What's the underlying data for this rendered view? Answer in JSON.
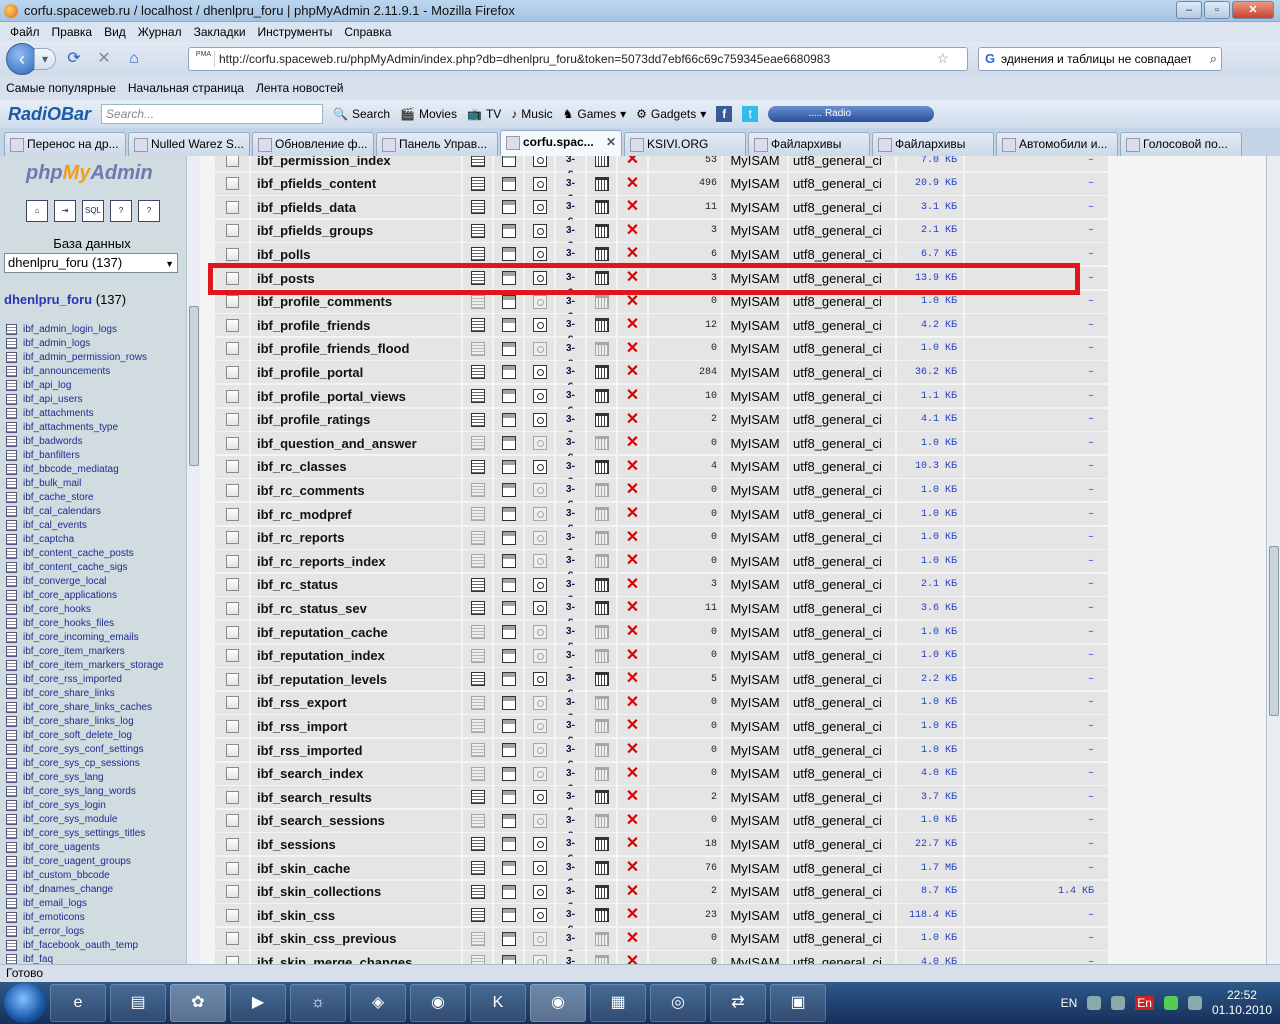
{
  "window": {
    "title": "corfu.spaceweb.ru / localhost / dhenlpru_foru | phpMyAdmin 2.11.9.1 - Mozilla Firefox"
  },
  "menu": [
    "Файл",
    "Правка",
    "Вид",
    "Журнал",
    "Закладки",
    "Инструменты",
    "Справка"
  ],
  "nav": {
    "url": "http://corfu.spaceweb.ru/phpMyAdmin/index.php?db=dhenlpru_foru&token=5073dd7ebf66c69c759345eae6680983",
    "search_value": "эдинения и таблицы не совпадает:"
  },
  "bookmarks": [
    "Самые популярные",
    "Начальная страница",
    "Лента новостей"
  ],
  "radiobar": {
    "logo": "RadiOBar",
    "search_placeholder": "Search...",
    "items": [
      "Search",
      "Movies",
      "TV",
      "Music",
      "Games",
      "Gadgets"
    ],
    "radio_label": "..... Radio"
  },
  "tabs": [
    "Перенос на др...",
    "Nulled Warez S...",
    "Обновление ф...",
    "Панель Управ...",
    "corfu.spac...",
    "KSIVI.ORG",
    "Файлархивы",
    "Файлархивы",
    "Автомобили и...",
    "Голосовой по..."
  ],
  "active_tab": 4,
  "sidebar": {
    "db_label": "База данных",
    "db_select": "dhenlpru_foru (137)",
    "db_name": "dhenlpru_foru",
    "db_count": "(137)",
    "icon_labels": [
      "home",
      "exit",
      "SQL",
      "docs",
      "docs2"
    ],
    "tables": [
      "ibf_admin_login_logs",
      "ibf_admin_logs",
      "ibf_admin_permission_rows",
      "ibf_announcements",
      "ibf_api_log",
      "ibf_api_users",
      "ibf_attachments",
      "ibf_attachments_type",
      "ibf_badwords",
      "ibf_banfilters",
      "ibf_bbcode_mediatag",
      "ibf_bulk_mail",
      "ibf_cache_store",
      "ibf_cal_calendars",
      "ibf_cal_events",
      "ibf_captcha",
      "ibf_content_cache_posts",
      "ibf_content_cache_sigs",
      "ibf_converge_local",
      "ibf_core_applications",
      "ibf_core_hooks",
      "ibf_core_hooks_files",
      "ibf_core_incoming_emails",
      "ibf_core_item_markers",
      "ibf_core_item_markers_storage",
      "ibf_core_rss_imported",
      "ibf_core_share_links",
      "ibf_core_share_links_caches",
      "ibf_core_share_links_log",
      "ibf_core_soft_delete_log",
      "ibf_core_sys_conf_settings",
      "ibf_core_sys_cp_sessions",
      "ibf_core_sys_lang",
      "ibf_core_sys_lang_words",
      "ibf_core_sys_login",
      "ibf_core_sys_module",
      "ibf_core_sys_settings_titles",
      "ibf_core_uagents",
      "ibf_core_uagent_groups",
      "ibf_custom_bbcode",
      "ibf_dnames_change",
      "ibf_email_logs",
      "ibf_emoticons",
      "ibf_error_logs",
      "ibf_facebook_oauth_temp",
      "ibf_faq"
    ]
  },
  "table_rows": [
    {
      "name": "ibf_permission_index",
      "rows": "53",
      "engine": "MyISAM",
      "collation": "utf8_general_ci",
      "size": "7.0 КБ",
      "overhead": "–",
      "empty": false
    },
    {
      "name": "ibf_pfields_content",
      "rows": "496",
      "engine": "MyISAM",
      "collation": "utf8_general_ci",
      "size": "20.9 КБ",
      "overhead": "–",
      "empty": false
    },
    {
      "name": "ibf_pfields_data",
      "rows": "11",
      "engine": "MyISAM",
      "collation": "utf8_general_ci",
      "size": "3.1 КБ",
      "overhead": "–",
      "empty": false
    },
    {
      "name": "ibf_pfields_groups",
      "rows": "3",
      "engine": "MyISAM",
      "collation": "utf8_general_ci",
      "size": "2.1 КБ",
      "overhead": "–",
      "empty": false
    },
    {
      "name": "ibf_polls",
      "rows": "6",
      "engine": "MyISAM",
      "collation": "utf8_general_ci",
      "size": "6.7 КБ",
      "overhead": "–",
      "empty": false
    },
    {
      "name": "ibf_posts",
      "rows": "3",
      "engine": "MyISAM",
      "collation": "utf8_general_ci",
      "size": "13.9 КБ",
      "overhead": "–",
      "empty": false
    },
    {
      "name": "ibf_profile_comments",
      "rows": "0",
      "engine": "MyISAM",
      "collation": "utf8_general_ci",
      "size": "1.0 КБ",
      "overhead": "–",
      "empty": true
    },
    {
      "name": "ibf_profile_friends",
      "rows": "12",
      "engine": "MyISAM",
      "collation": "utf8_general_ci",
      "size": "4.2 КБ",
      "overhead": "–",
      "empty": false
    },
    {
      "name": "ibf_profile_friends_flood",
      "rows": "0",
      "engine": "MyISAM",
      "collation": "utf8_general_ci",
      "size": "1.0 КБ",
      "overhead": "–",
      "empty": true
    },
    {
      "name": "ibf_profile_portal",
      "rows": "284",
      "engine": "MyISAM",
      "collation": "utf8_general_ci",
      "size": "36.2 КБ",
      "overhead": "–",
      "empty": false
    },
    {
      "name": "ibf_profile_portal_views",
      "rows": "10",
      "engine": "MyISAM",
      "collation": "utf8_general_ci",
      "size": "1.1 КБ",
      "overhead": "–",
      "empty": false
    },
    {
      "name": "ibf_profile_ratings",
      "rows": "2",
      "engine": "MyISAM",
      "collation": "utf8_general_ci",
      "size": "4.1 КБ",
      "overhead": "–",
      "empty": false
    },
    {
      "name": "ibf_question_and_answer",
      "rows": "0",
      "engine": "MyISAM",
      "collation": "utf8_general_ci",
      "size": "1.0 КБ",
      "overhead": "–",
      "empty": true
    },
    {
      "name": "ibf_rc_classes",
      "rows": "4",
      "engine": "MyISAM",
      "collation": "utf8_general_ci",
      "size": "10.3 КБ",
      "overhead": "–",
      "empty": false
    },
    {
      "name": "ibf_rc_comments",
      "rows": "0",
      "engine": "MyISAM",
      "collation": "utf8_general_ci",
      "size": "1.0 КБ",
      "overhead": "–",
      "empty": true
    },
    {
      "name": "ibf_rc_modpref",
      "rows": "0",
      "engine": "MyISAM",
      "collation": "utf8_general_ci",
      "size": "1.0 КБ",
      "overhead": "–",
      "empty": true
    },
    {
      "name": "ibf_rc_reports",
      "rows": "0",
      "engine": "MyISAM",
      "collation": "utf8_general_ci",
      "size": "1.0 КБ",
      "overhead": "–",
      "empty": true
    },
    {
      "name": "ibf_rc_reports_index",
      "rows": "0",
      "engine": "MyISAM",
      "collation": "utf8_general_ci",
      "size": "1.0 КБ",
      "overhead": "–",
      "empty": true
    },
    {
      "name": "ibf_rc_status",
      "rows": "3",
      "engine": "MyISAM",
      "collation": "utf8_general_ci",
      "size": "2.1 КБ",
      "overhead": "–",
      "empty": false
    },
    {
      "name": "ibf_rc_status_sev",
      "rows": "11",
      "engine": "MyISAM",
      "collation": "utf8_general_ci",
      "size": "3.6 КБ",
      "overhead": "–",
      "empty": false
    },
    {
      "name": "ibf_reputation_cache",
      "rows": "0",
      "engine": "MyISAM",
      "collation": "utf8_general_ci",
      "size": "1.0 КБ",
      "overhead": "–",
      "empty": true
    },
    {
      "name": "ibf_reputation_index",
      "rows": "0",
      "engine": "MyISAM",
      "collation": "utf8_general_ci",
      "size": "1.0 КБ",
      "overhead": "–",
      "empty": true
    },
    {
      "name": "ibf_reputation_levels",
      "rows": "5",
      "engine": "MyISAM",
      "collation": "utf8_general_ci",
      "size": "2.2 КБ",
      "overhead": "–",
      "empty": false
    },
    {
      "name": "ibf_rss_export",
      "rows": "0",
      "engine": "MyISAM",
      "collation": "utf8_general_ci",
      "size": "1.0 КБ",
      "overhead": "–",
      "empty": true
    },
    {
      "name": "ibf_rss_import",
      "rows": "0",
      "engine": "MyISAM",
      "collation": "utf8_general_ci",
      "size": "1.0 КБ",
      "overhead": "–",
      "empty": true
    },
    {
      "name": "ibf_rss_imported",
      "rows": "0",
      "engine": "MyISAM",
      "collation": "utf8_general_ci",
      "size": "1.0 КБ",
      "overhead": "–",
      "empty": true
    },
    {
      "name": "ibf_search_index",
      "rows": "0",
      "engine": "MyISAM",
      "collation": "utf8_general_ci",
      "size": "4.0 КБ",
      "overhead": "–",
      "empty": true
    },
    {
      "name": "ibf_search_results",
      "rows": "2",
      "engine": "MyISAM",
      "collation": "utf8_general_ci",
      "size": "3.7 КБ",
      "overhead": "–",
      "empty": false
    },
    {
      "name": "ibf_search_sessions",
      "rows": "0",
      "engine": "MyISAM",
      "collation": "utf8_general_ci",
      "size": "1.0 КБ",
      "overhead": "–",
      "empty": true
    },
    {
      "name": "ibf_sessions",
      "rows": "18",
      "engine": "MyISAM",
      "collation": "utf8_general_ci",
      "size": "22.7 КБ",
      "overhead": "–",
      "empty": false
    },
    {
      "name": "ibf_skin_cache",
      "rows": "76",
      "engine": "MyISAM",
      "collation": "utf8_general_ci",
      "size": "1.7 МБ",
      "overhead": "–",
      "empty": false
    },
    {
      "name": "ibf_skin_collections",
      "rows": "2",
      "engine": "MyISAM",
      "collation": "utf8_general_ci",
      "size": "8.7 КБ",
      "overhead": "1.4 КБ",
      "empty": false
    },
    {
      "name": "ibf_skin_css",
      "rows": "23",
      "engine": "MyISAM",
      "collation": "utf8_general_ci",
      "size": "118.4 КБ",
      "overhead": "–",
      "empty": false
    },
    {
      "name": "ibf_skin_css_previous",
      "rows": "0",
      "engine": "MyISAM",
      "collation": "utf8_general_ci",
      "size": "1.0 КБ",
      "overhead": "–",
      "empty": true
    },
    {
      "name": "ibf_skin_merge_changes",
      "rows": "0",
      "engine": "MyISAM",
      "collation": "utf8_general_ci",
      "size": "4.0 КБ",
      "overhead": "–",
      "empty": true
    }
  ],
  "statusbar": {
    "text": "Готово"
  },
  "taskbar": {
    "lang": "En",
    "lang2": "EN",
    "time": "22:52",
    "date": "01.10.2010"
  },
  "colors": {
    "highlight": "#e0161b",
    "row_bg": "#e5e5e5",
    "link_blue": "#1d3fc8",
    "sidebar_bg": "#d0dce0"
  }
}
